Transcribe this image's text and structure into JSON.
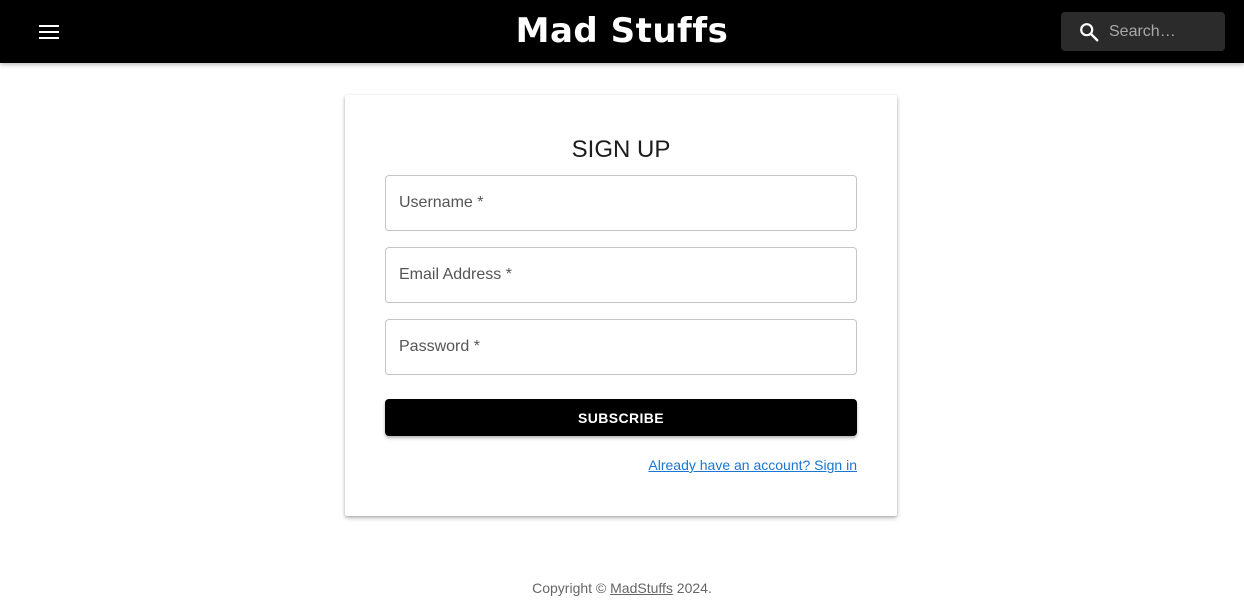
{
  "header": {
    "brand": "Mad Stuffs",
    "menu_icon": "hamburger-menu-icon",
    "search": {
      "icon": "search-icon",
      "placeholder": "Search…",
      "value": ""
    }
  },
  "signup": {
    "title": "SIGN UP",
    "fields": {
      "username": {
        "label": "Username *",
        "value": ""
      },
      "email": {
        "label": "Email Address *",
        "value": ""
      },
      "password": {
        "label": "Password *",
        "value": ""
      }
    },
    "submit_label": "SUBSCRIBE",
    "signin_link": "Already have an account? Sign in"
  },
  "footer": {
    "prefix": "Copyright © ",
    "link": "MadStuffs",
    "suffix": " 2024."
  },
  "colors": {
    "appbar": "#000000",
    "search_bg": "#2b2b2b",
    "button": "#000000",
    "link": "#1976d2"
  }
}
